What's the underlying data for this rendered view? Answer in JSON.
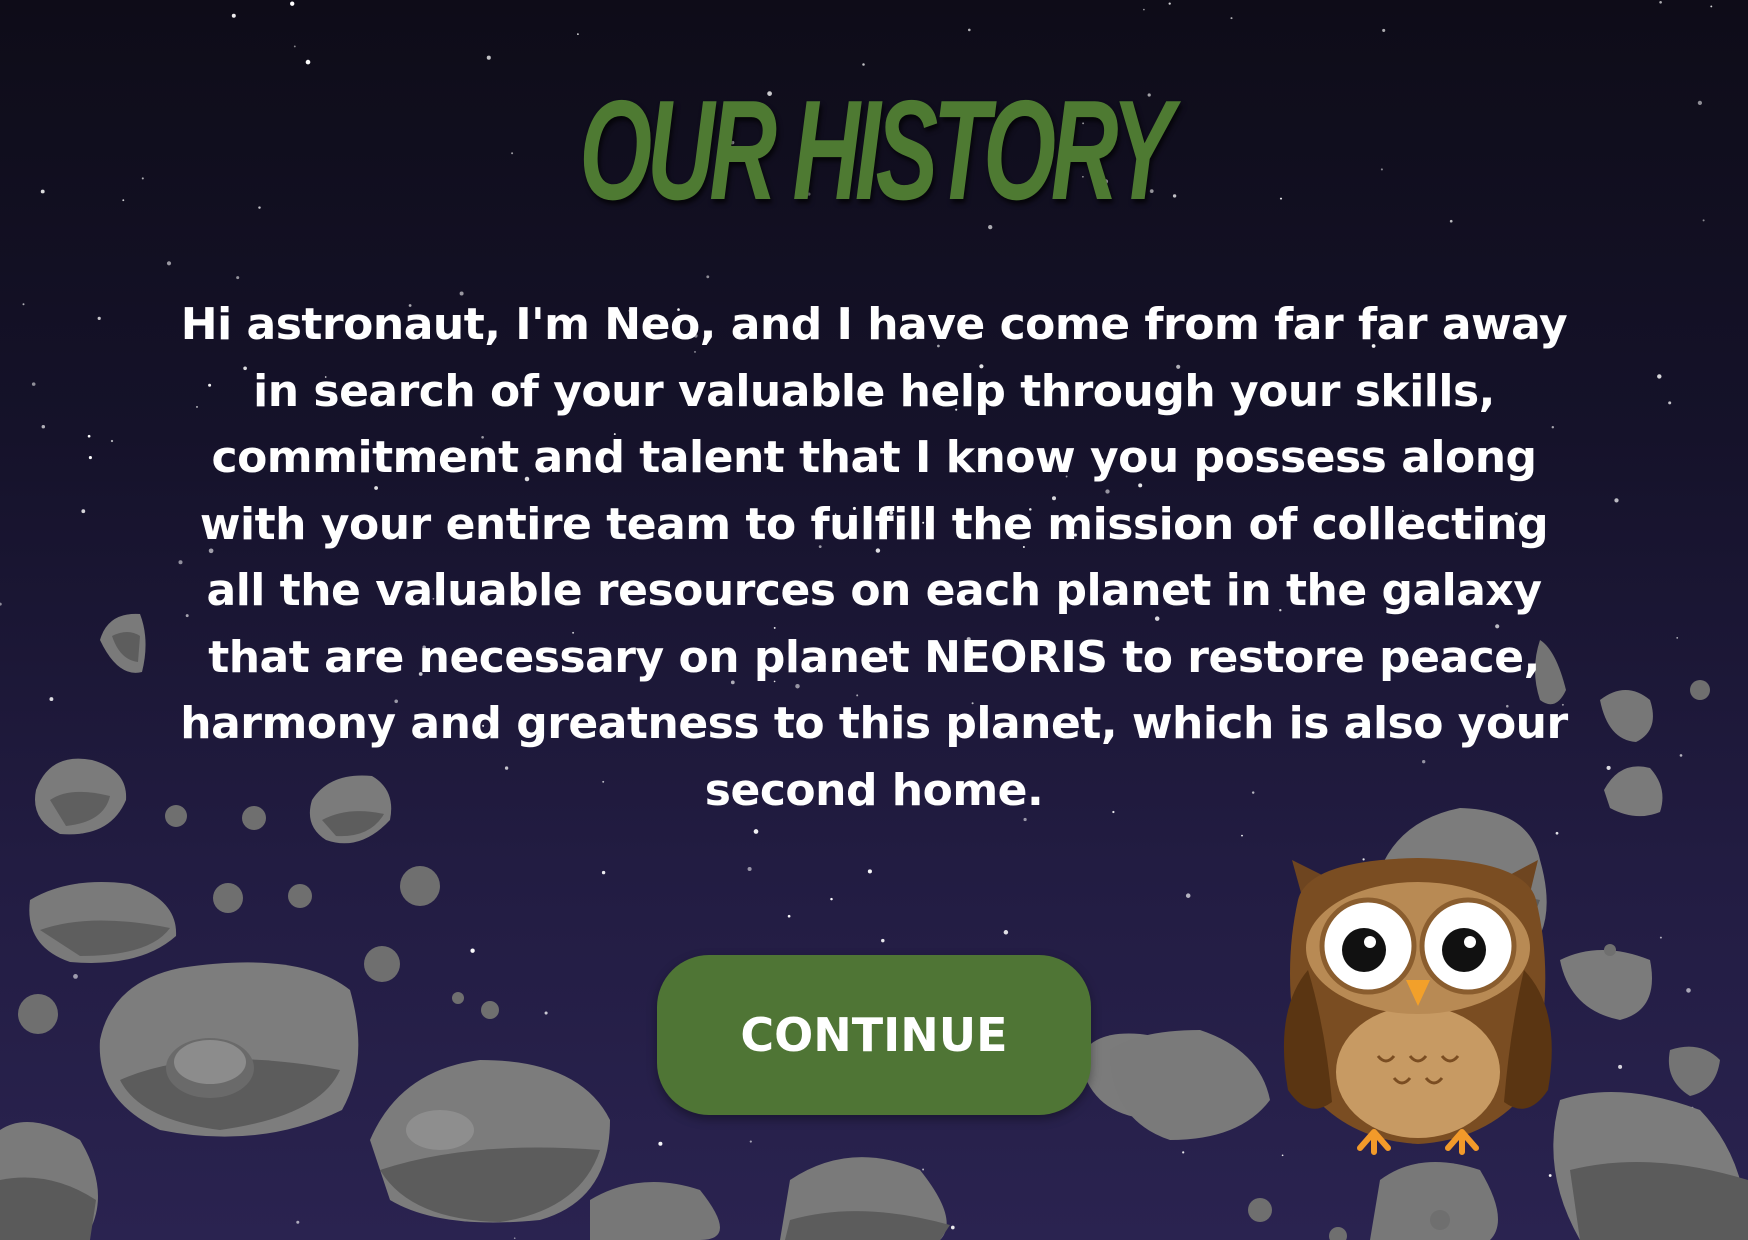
{
  "page": {
    "title": "OUR HISTORY",
    "story": "Hi astronaut, I'm Neo, and I have come from far far away in search of your valuable help through your skills, commitment and talent that I know you possess along with your entire team to fulfill the mission of collecting all the valuable resources on each planet in the galaxy that are necessary on planet NEORIS to restore peace, harmony and greatness to this planet, which is also your second home.",
    "continue_label": "CONTINUE"
  },
  "colors": {
    "title_green": "#4e7a32",
    "button_green": "#4f7535",
    "background_top": "#0e0c18",
    "background_bottom": "#2a2350",
    "text": "#ffffff",
    "rock_base": "#7b7b7b",
    "rock_shadow": "#555555"
  },
  "icons": {
    "mascot": "owl-mascot"
  }
}
